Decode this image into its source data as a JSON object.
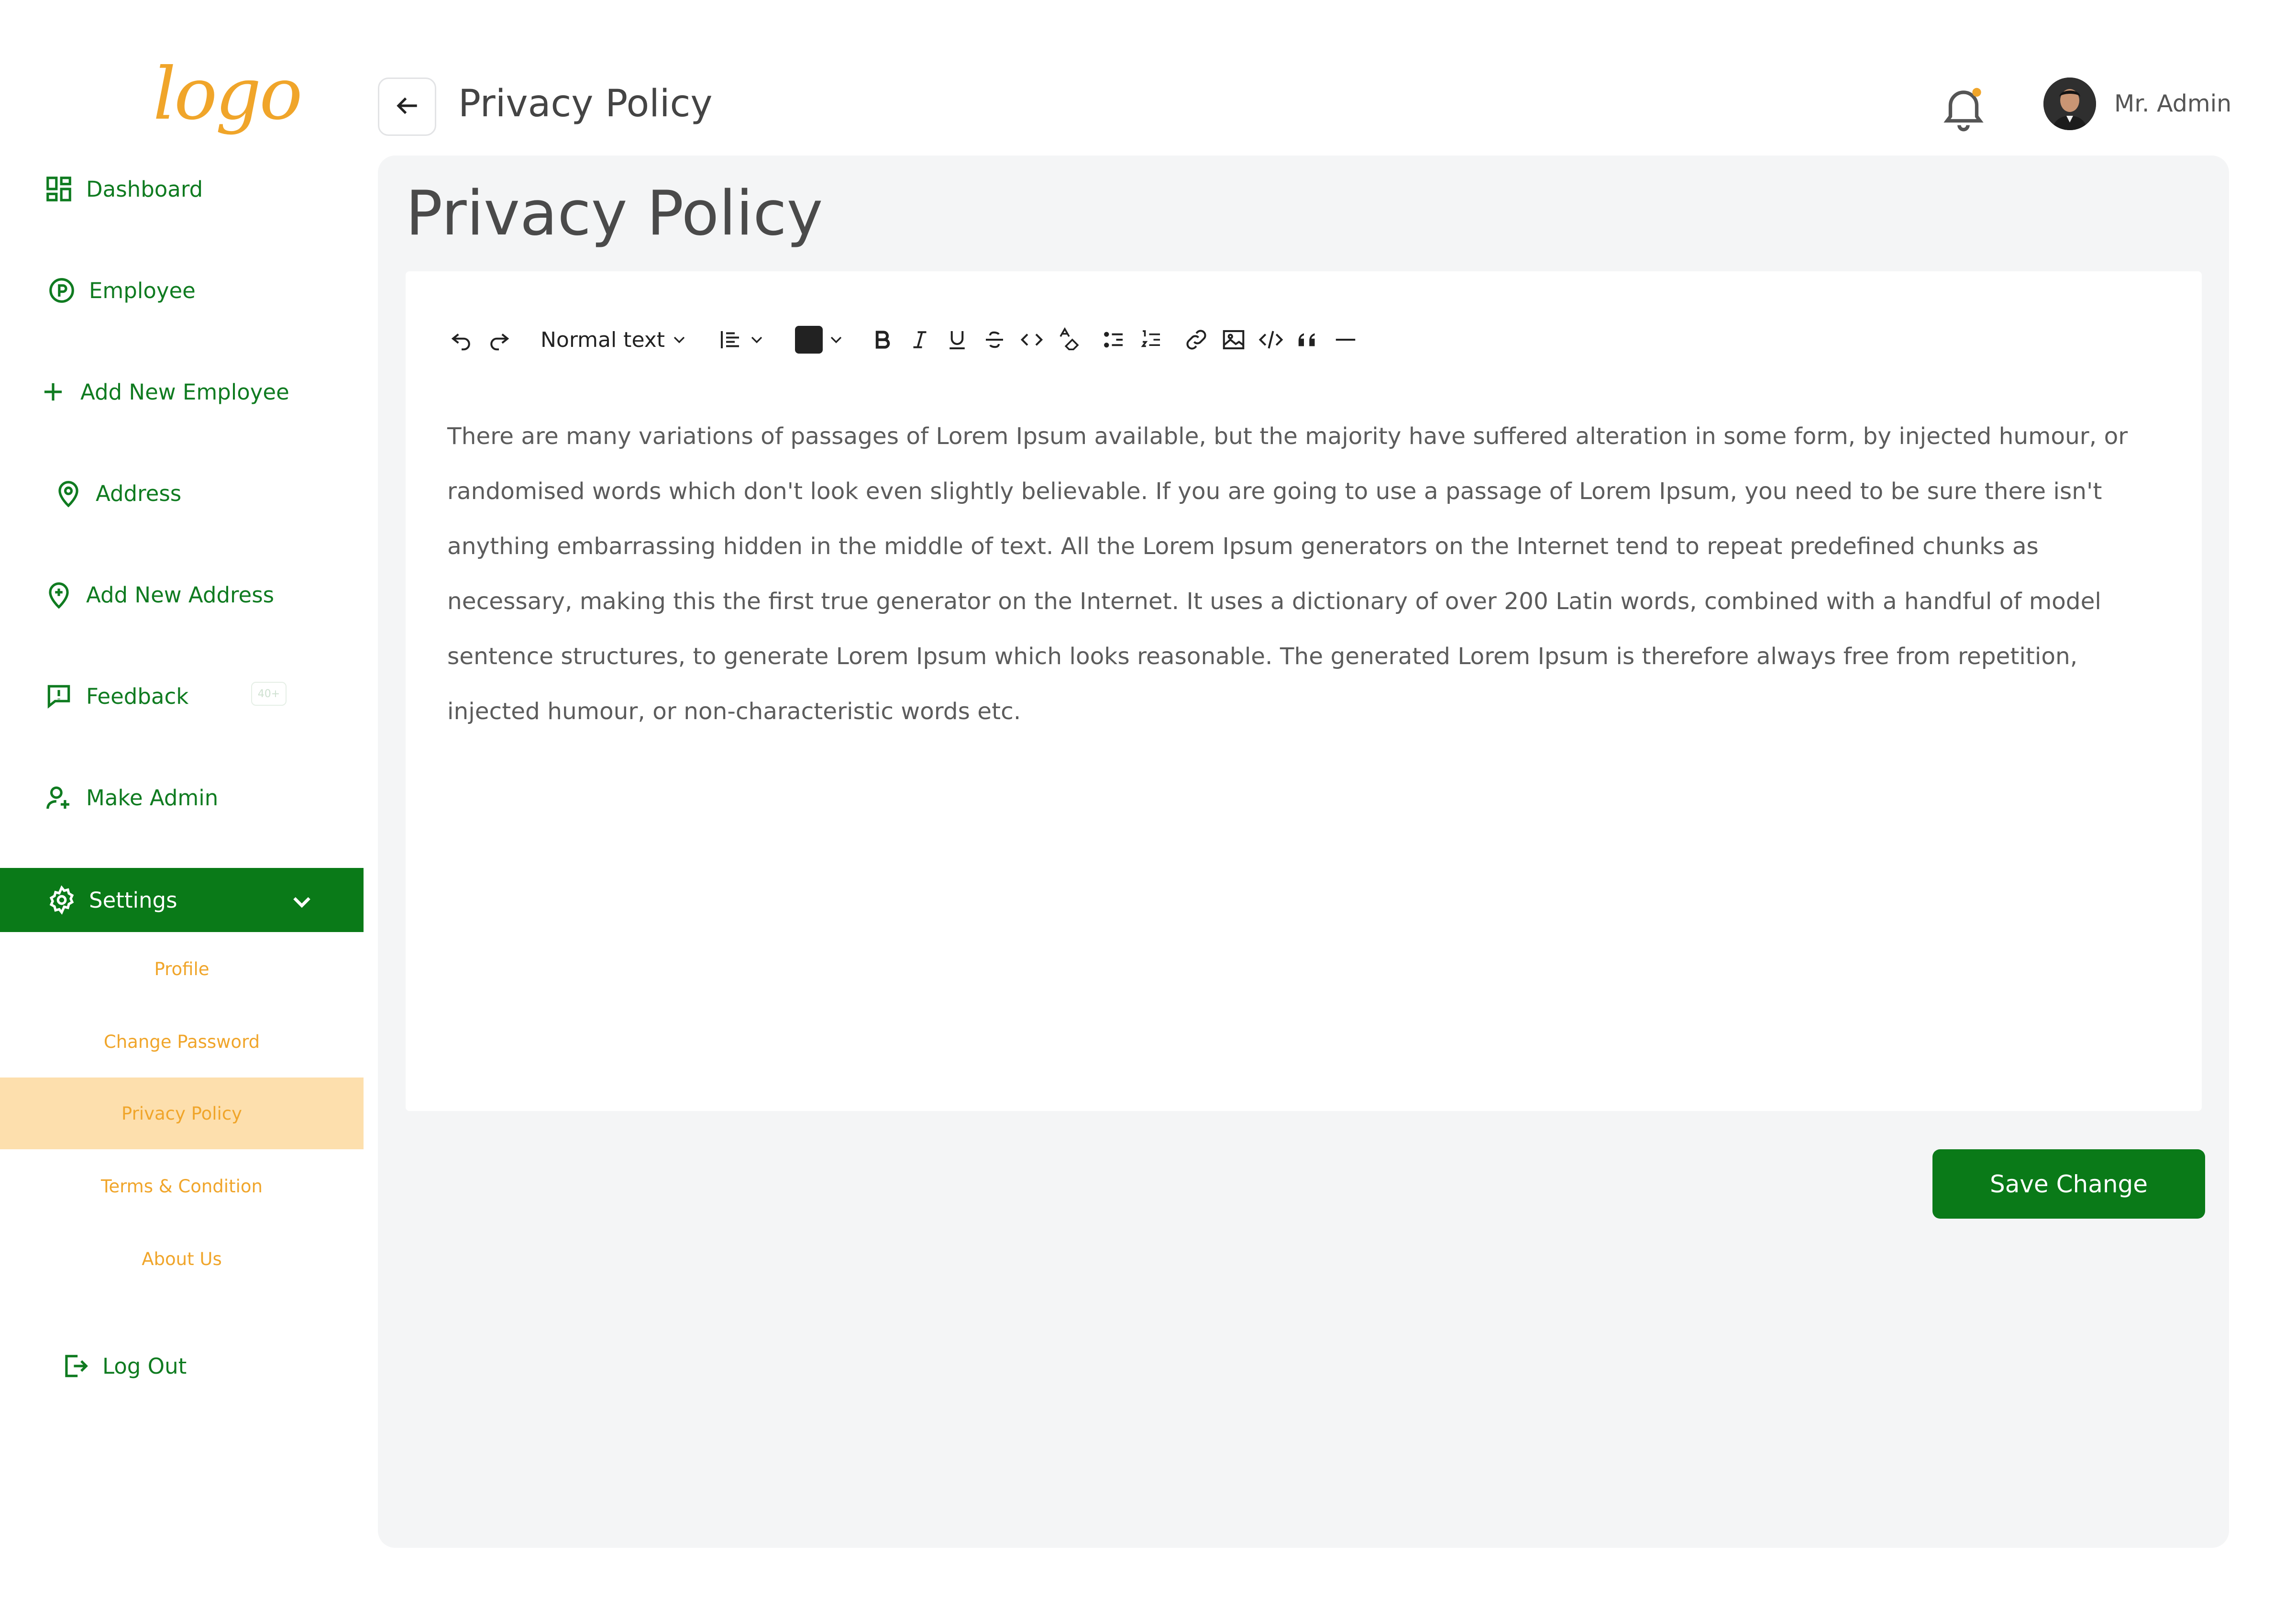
{
  "brand": {
    "logo_text": "logo"
  },
  "colors": {
    "primary_green": "#0a7a18",
    "accent_orange": "#f0a52a",
    "active_sub_bg": "#fddfad",
    "panel_bg": "#f4f5f6"
  },
  "sidebar": {
    "items": [
      {
        "label": "Dashboard",
        "icon": "dashboard-icon"
      },
      {
        "label": "Employee",
        "icon": "parking-circle-icon"
      },
      {
        "label": "Add New Employee",
        "icon": "plus-icon"
      },
      {
        "label": "Address",
        "icon": "map-pin-icon"
      },
      {
        "label": "Add New Address",
        "icon": "map-pin-plus-icon"
      },
      {
        "label": "Feedback",
        "icon": "feedback-icon",
        "badge": "40+"
      },
      {
        "label": "Make Admin",
        "icon": "user-plus-icon"
      },
      {
        "label": "Settings",
        "icon": "gear-icon",
        "expanded": true
      }
    ],
    "settings_sub": [
      {
        "label": "Profile"
      },
      {
        "label": "Change Password"
      },
      {
        "label": "Privacy Policy",
        "active": true
      },
      {
        "label": "Terms & Condition"
      },
      {
        "label": "About Us"
      }
    ],
    "logout": {
      "label": "Log Out",
      "icon": "logout-icon"
    }
  },
  "header": {
    "title": "Privacy Policy",
    "user_name": "Mr. Admin",
    "has_notification": true
  },
  "page": {
    "heading": "Privacy Policy",
    "toolbar": {
      "text_style": "Normal text",
      "text_color": "#222222"
    },
    "body": "There are many variations of passages of Lorem Ipsum available, but the majority have suffered alteration in some form, by injected humour, or randomised words which don't look even slightly believable. If you are going to use a passage of Lorem Ipsum, you need to be sure there isn't anything embarrassing hidden in the middle of text. All the Lorem Ipsum generators on the Internet tend to repeat predefined chunks as necessary, making this the first true generator on the Internet. It uses a dictionary of over 200 Latin words, combined with a handful of model sentence structures, to generate Lorem Ipsum which looks reasonable. The generated Lorem Ipsum is therefore always free from repetition, injected humour, or non-characteristic words etc.",
    "save_label": "Save Change"
  }
}
